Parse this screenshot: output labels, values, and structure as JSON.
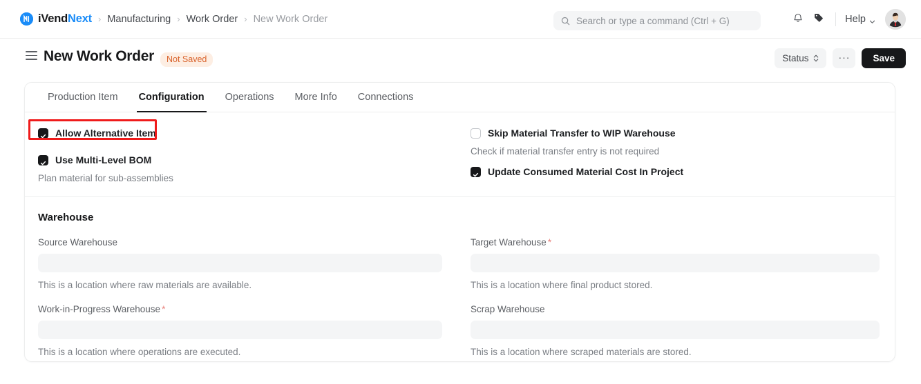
{
  "navbar": {
    "brand": {
      "prefix": "iVend",
      "suffix": "Next",
      "mark": "N"
    },
    "breadcrumbs": [
      {
        "label": "Manufacturing",
        "current": false
      },
      {
        "label": "Work Order",
        "current": false
      },
      {
        "label": "New Work Order",
        "current": true
      }
    ],
    "separator": "›",
    "search": {
      "placeholder": "Search or type a command (Ctrl + G)",
      "value": "",
      "icon": "search-icon"
    },
    "notifications_icon": "bell-icon",
    "tags_icon": "tag-icon",
    "help": {
      "label": "Help",
      "chevron": "chevron-down-icon"
    },
    "avatar_icon": "user-avatar"
  },
  "pagehead": {
    "menu_icon": "hamburger-icon",
    "title": "New Work Order",
    "status_badge": "Not Saved",
    "status_button": {
      "label": "Status",
      "icon": "up-down-chevron-icon"
    },
    "more_button": "···",
    "save_button": "Save"
  },
  "tabs": [
    {
      "label": "Production Item",
      "active": false
    },
    {
      "label": "Configuration",
      "active": true
    },
    {
      "label": "Operations",
      "active": false
    },
    {
      "label": "More Info",
      "active": false
    },
    {
      "label": "Connections",
      "active": false
    }
  ],
  "options": {
    "left": [
      {
        "label": "Allow Alternative Item",
        "checked": true,
        "description": "",
        "highlighted": true
      },
      {
        "label": "Use Multi-Level BOM",
        "checked": true,
        "description": "Plan material for sub-assemblies",
        "highlighted": false
      }
    ],
    "right": [
      {
        "label": "Skip Material Transfer to WIP Warehouse",
        "checked": false,
        "description": "Check if material transfer entry is not required",
        "highlighted": false
      },
      {
        "label": "Update Consumed Material Cost In Project",
        "checked": true,
        "description": "",
        "highlighted": false
      }
    ]
  },
  "warehouse": {
    "section_title": "Warehouse",
    "fields": {
      "source": {
        "label": "Source Warehouse",
        "required": false,
        "value": "",
        "help": "This is a location where raw materials are available."
      },
      "target": {
        "label": "Target Warehouse",
        "required": true,
        "required_mark": "*",
        "value": "",
        "help": "This is a location where final product stored."
      },
      "wip": {
        "label": "Work-in-Progress Warehouse",
        "required": true,
        "required_mark": "*",
        "value": "",
        "help": "This is a location where operations are executed."
      },
      "scrap": {
        "label": "Scrap Warehouse",
        "required": false,
        "value": "",
        "help": "This is a location where scraped materials are stored."
      }
    }
  },
  "annotation": {
    "target": "allow-alternative-item-checkbox",
    "color": "#ef1b1b"
  },
  "colors": {
    "brand_blue": "#1a8cf8",
    "badge_bg": "#fdeee3",
    "badge_text": "#d9622b",
    "save_bg": "#17181a",
    "required_star": "#e8837d",
    "input_bg": "#f4f5f6",
    "annotation": "#ef1b1b"
  }
}
